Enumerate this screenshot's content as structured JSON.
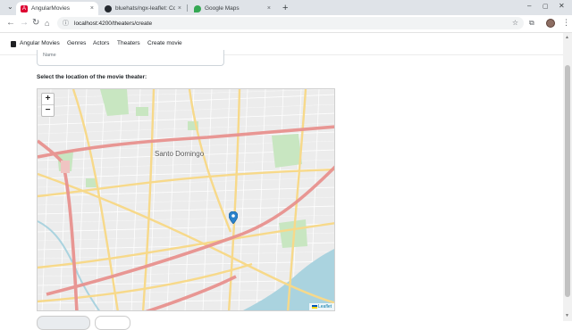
{
  "browser": {
    "tabs": [
      {
        "title": "AngularMovies",
        "favicon_color": "#dd0031"
      },
      {
        "title": "bluehats/ngx-leaflet: Core Leaf",
        "favicon_color": "#24292f"
      },
      {
        "title": "Google Maps",
        "favicon_color": "#34a853"
      }
    ],
    "url": "localhost:4200/theaters/create",
    "new_tab_glyph": "+"
  },
  "navbar": {
    "brand": "Angular Movies",
    "links": [
      "Genres",
      "Actors",
      "Theaters",
      "Create movie"
    ]
  },
  "form": {
    "name_label": "Name",
    "location_label": "Select the location of the movie theater:"
  },
  "map": {
    "zoom_in": "+",
    "zoom_out": "−",
    "city_label": "Santo Domingo",
    "attribution": "Leaflet",
    "land_color": "#ececec",
    "water_color": "#aad3df",
    "park_color": "#c8e6c1",
    "major_road_color": "#e8928f",
    "road_color": "#f7d98a",
    "marker_color": "#2a81cb"
  },
  "icons": {
    "back": "arrow-left-icon",
    "forward": "arrow-right-icon",
    "reload": "reload-icon",
    "home": "home-icon",
    "site_info": "site-info-icon",
    "bookmark": "star-icon",
    "extensions": "extensions-icon",
    "menu": "kebab-menu-icon"
  }
}
